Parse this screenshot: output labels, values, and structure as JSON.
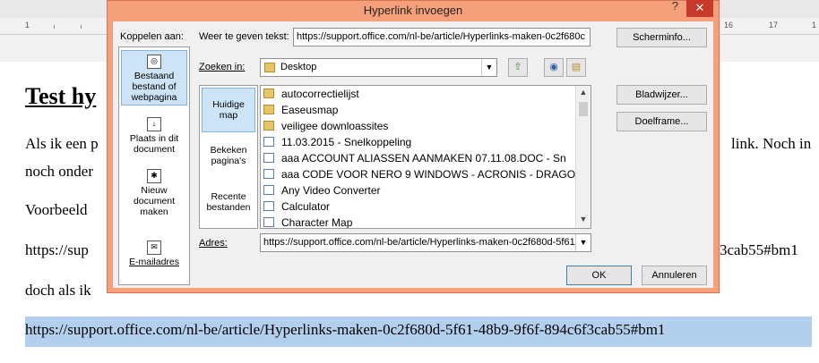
{
  "document": {
    "ruler": [
      "1",
      "16",
      "17",
      "1"
    ],
    "title": "Test hy",
    "lines": [
      {
        "left": "Als ik een p",
        "right": "link. Noch in"
      },
      {
        "left": "noch onder",
        "right": ""
      },
      {
        "left": "Voorbeeld",
        "right": ""
      },
      {
        "left": "https://sup",
        "right": "3cab55#bm1"
      },
      {
        "left": "doch als ik",
        "right": ""
      }
    ],
    "selected_link": "https://support.office.com/nl-be/article/Hyperlinks-maken-0c2f680d-5f61-48b9-9f6f-894c6f3cab55#bm1"
  },
  "dialog": {
    "title": "Hyperlink invoegen",
    "help": "?",
    "close": "✕",
    "link_to_label": "Koppelen aan:",
    "link_to_items": [
      {
        "label": "Bestaand bestand of webpagina",
        "icon": "globe-page-icon",
        "active": true
      },
      {
        "label": "Plaats in dit document",
        "icon": "document-place-icon",
        "active": false
      },
      {
        "label": "Nieuw document maken",
        "icon": "new-document-icon",
        "active": false
      },
      {
        "label": "E-mailadres",
        "icon": "email-icon",
        "active": false
      }
    ],
    "display_text_label": "Weer te geven tekst:",
    "display_text_value": "https://support.office.com/nl-be/article/Hyperlinks-maken-0c2f680c",
    "screentip_button": "Scherminfo...",
    "look_in_label": "Zoeken in:",
    "look_in_value": "Desktop",
    "browse_items": [
      {
        "label": "Huidige map",
        "active": true
      },
      {
        "label": "Bekeken pagina's",
        "active": false
      },
      {
        "label": "Recente bestanden",
        "active": false
      }
    ],
    "files": [
      {
        "name": "autocorrectielijst",
        "type": "folder"
      },
      {
        "name": "Easeusmap",
        "type": "folder"
      },
      {
        "name": "veiligee downloassites",
        "type": "folder"
      },
      {
        "name": "11.03.2015 - Snelkoppeling",
        "type": "shortcut"
      },
      {
        "name": "aaa ACCOUNT  ALIASSEN AANMAKEN 07.11.08.DOC - Sn",
        "type": "shortcut"
      },
      {
        "name": "aaa CODE VOOR NERO 9 WINDOWS - ACRONIS - DRAGO",
        "type": "shortcut"
      },
      {
        "name": "Any Video Converter",
        "type": "shortcut"
      },
      {
        "name": "Calculator",
        "type": "shortcut"
      },
      {
        "name": "Character Map",
        "type": "shortcut"
      }
    ],
    "bookmark_button": "Bladwijzer...",
    "target_frame_button": "Doelframe...",
    "address_label": "Adres:",
    "address_value": "https://support.office.com/nl-be/article/Hyperlinks-maken-0c2f680d-5f61",
    "ok_button": "OK",
    "cancel_button": "Annuleren"
  }
}
